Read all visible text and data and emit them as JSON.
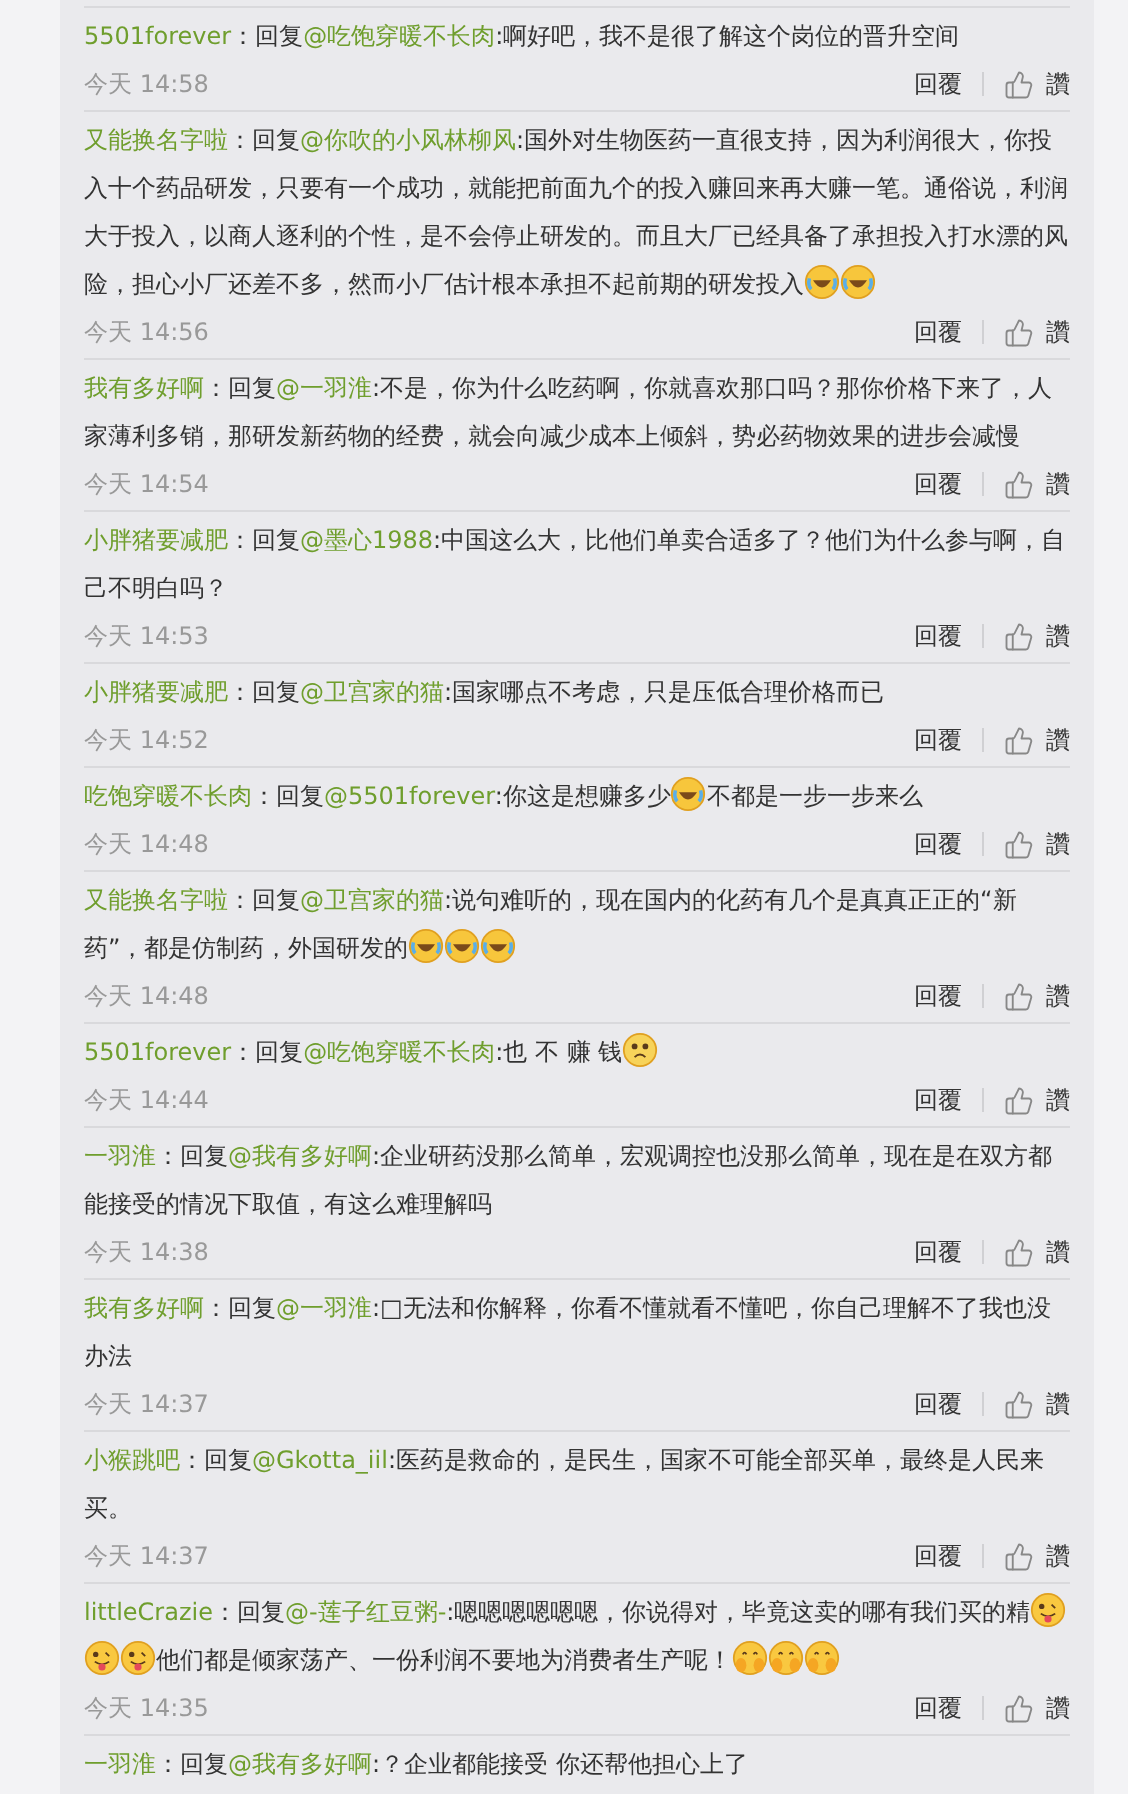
{
  "comments": [
    {
      "user": "5501forever",
      "prefix": "：回复",
      "target": "@吃饱穿暖不长肉",
      "body": [
        {
          "kind": "text",
          "text": ":啊好吧，我不是很了解这个岗位的晋升空间"
        }
      ],
      "time": "今天 14:58",
      "reply": "回覆",
      "like": "讚"
    },
    {
      "user": "又能换名字啦",
      "prefix": "：回复",
      "target": "@你吹的小风林柳风",
      "body": [
        {
          "kind": "text",
          "text": ":国外对生物医药一直很支持，因为利润很大，你投入十个药品研发，只要有一个成功，就能把前面九个的投入赚回来再大赚一笔。通俗说，利润大于投入，以商人逐利的个性，是不会停止研发的。而且大厂已经具备了承担投入打水漂的风险，担心小厂还差不多，然而小厂估计根本承担不起前期的研发投入"
        },
        {
          "kind": "laugh-cry"
        },
        {
          "kind": "laugh-cry"
        }
      ],
      "time": "今天 14:56",
      "reply": "回覆",
      "like": "讚"
    },
    {
      "user": "我有多好啊",
      "prefix": "：回复",
      "target": "@一羽淮",
      "body": [
        {
          "kind": "text",
          "text": ":不是，你为什么吃药啊，你就喜欢那口吗？那你价格下来了，人家薄利多销，那研发新药物的经费，就会向减少成本上倾斜，势必药物效果的进步会减慢"
        }
      ],
      "time": "今天 14:54",
      "reply": "回覆",
      "like": "讚"
    },
    {
      "user": "小胖猪要减肥",
      "prefix": "：回复",
      "target": "@墨心1988",
      "body": [
        {
          "kind": "text",
          "text": ":中国这么大，比他们单卖合适多了？他们为什么参与啊，自己不明白吗？"
        }
      ],
      "time": "今天 14:53",
      "reply": "回覆",
      "like": "讚"
    },
    {
      "user": "小胖猪要减肥",
      "prefix": "：回复",
      "target": "@卫宫家的猫",
      "body": [
        {
          "kind": "text",
          "text": ":国家哪点不考虑，只是压低合理价格而已"
        }
      ],
      "time": "今天 14:52",
      "reply": "回覆",
      "like": "讚"
    },
    {
      "user": "吃饱穿暖不长肉",
      "prefix": "：回复",
      "target": "@5501forever",
      "body": [
        {
          "kind": "text",
          "text": ":你这是想赚多少"
        },
        {
          "kind": "laugh-cry"
        },
        {
          "kind": "text",
          "text": "不都是一步一步来么"
        }
      ],
      "time": "今天 14:48",
      "reply": "回覆",
      "like": "讚"
    },
    {
      "user": "又能换名字啦",
      "prefix": "：回复",
      "target": "@卫宫家的猫",
      "body": [
        {
          "kind": "text",
          "text": ":说句难听的，现在国内的化药有几个是真真正正的“新药”，都是仿制药，外国研发的"
        },
        {
          "kind": "laugh-cry"
        },
        {
          "kind": "laugh-cry"
        },
        {
          "kind": "laugh-cry"
        }
      ],
      "time": "今天 14:48",
      "reply": "回覆",
      "like": "讚"
    },
    {
      "user": "5501forever",
      "prefix": "：回复",
      "target": "@吃饱穿暖不长肉",
      "body": [
        {
          "kind": "text",
          "text": ":也 不 赚 钱"
        },
        {
          "kind": "sad"
        }
      ],
      "time": "今天 14:44",
      "reply": "回覆",
      "like": "讚"
    },
    {
      "user": "一羽淮",
      "prefix": "：回复",
      "target": "@我有多好啊",
      "body": [
        {
          "kind": "text",
          "text": ":企业研药没那么简单，宏观调控也没那么简单，现在是在双方都能接受的情况下取值，有这么难理解吗"
        }
      ],
      "time": "今天 14:38",
      "reply": "回覆",
      "like": "讚"
    },
    {
      "user": "我有多好啊",
      "prefix": "：回复",
      "target": "@一羽淮",
      "body": [
        {
          "kind": "text",
          "text": ":□无法和你解释，你看不懂就看不懂吧，你自己理解不了我也没办法"
        }
      ],
      "time": "今天 14:37",
      "reply": "回覆",
      "like": "讚"
    },
    {
      "user": "小猴跳吧",
      "prefix": "：回复",
      "target": "@Gkotta_iil",
      "body": [
        {
          "kind": "text",
          "text": ":医药是救命的，是民生，国家不可能全部买单，最终是人民来买。"
        }
      ],
      "time": "今天 14:37",
      "reply": "回覆",
      "like": "讚"
    },
    {
      "user": "littleCrazie",
      "prefix": "：回复",
      "target": "@-莲子红豆粥-",
      "body": [
        {
          "kind": "text",
          "text": ":嗯嗯嗯嗯嗯嗯，你说得对，毕竟这卖的哪有我们买的精"
        },
        {
          "kind": "tongue"
        },
        {
          "kind": "tongue"
        },
        {
          "kind": "tongue"
        },
        {
          "kind": "text",
          "text": "他们都是倾家荡产、一份利润不要地为消费者生产呢！"
        },
        {
          "kind": "shy"
        },
        {
          "kind": "shy"
        },
        {
          "kind": "shy"
        }
      ],
      "time": "今天 14:35",
      "reply": "回覆",
      "like": "讚"
    },
    {
      "user": "一羽淮",
      "prefix": "：回复",
      "target": "@我有多好啊",
      "body": [
        {
          "kind": "text",
          "text": ":？企业都能接受 你还帮他担心上了"
        }
      ]
    }
  ]
}
